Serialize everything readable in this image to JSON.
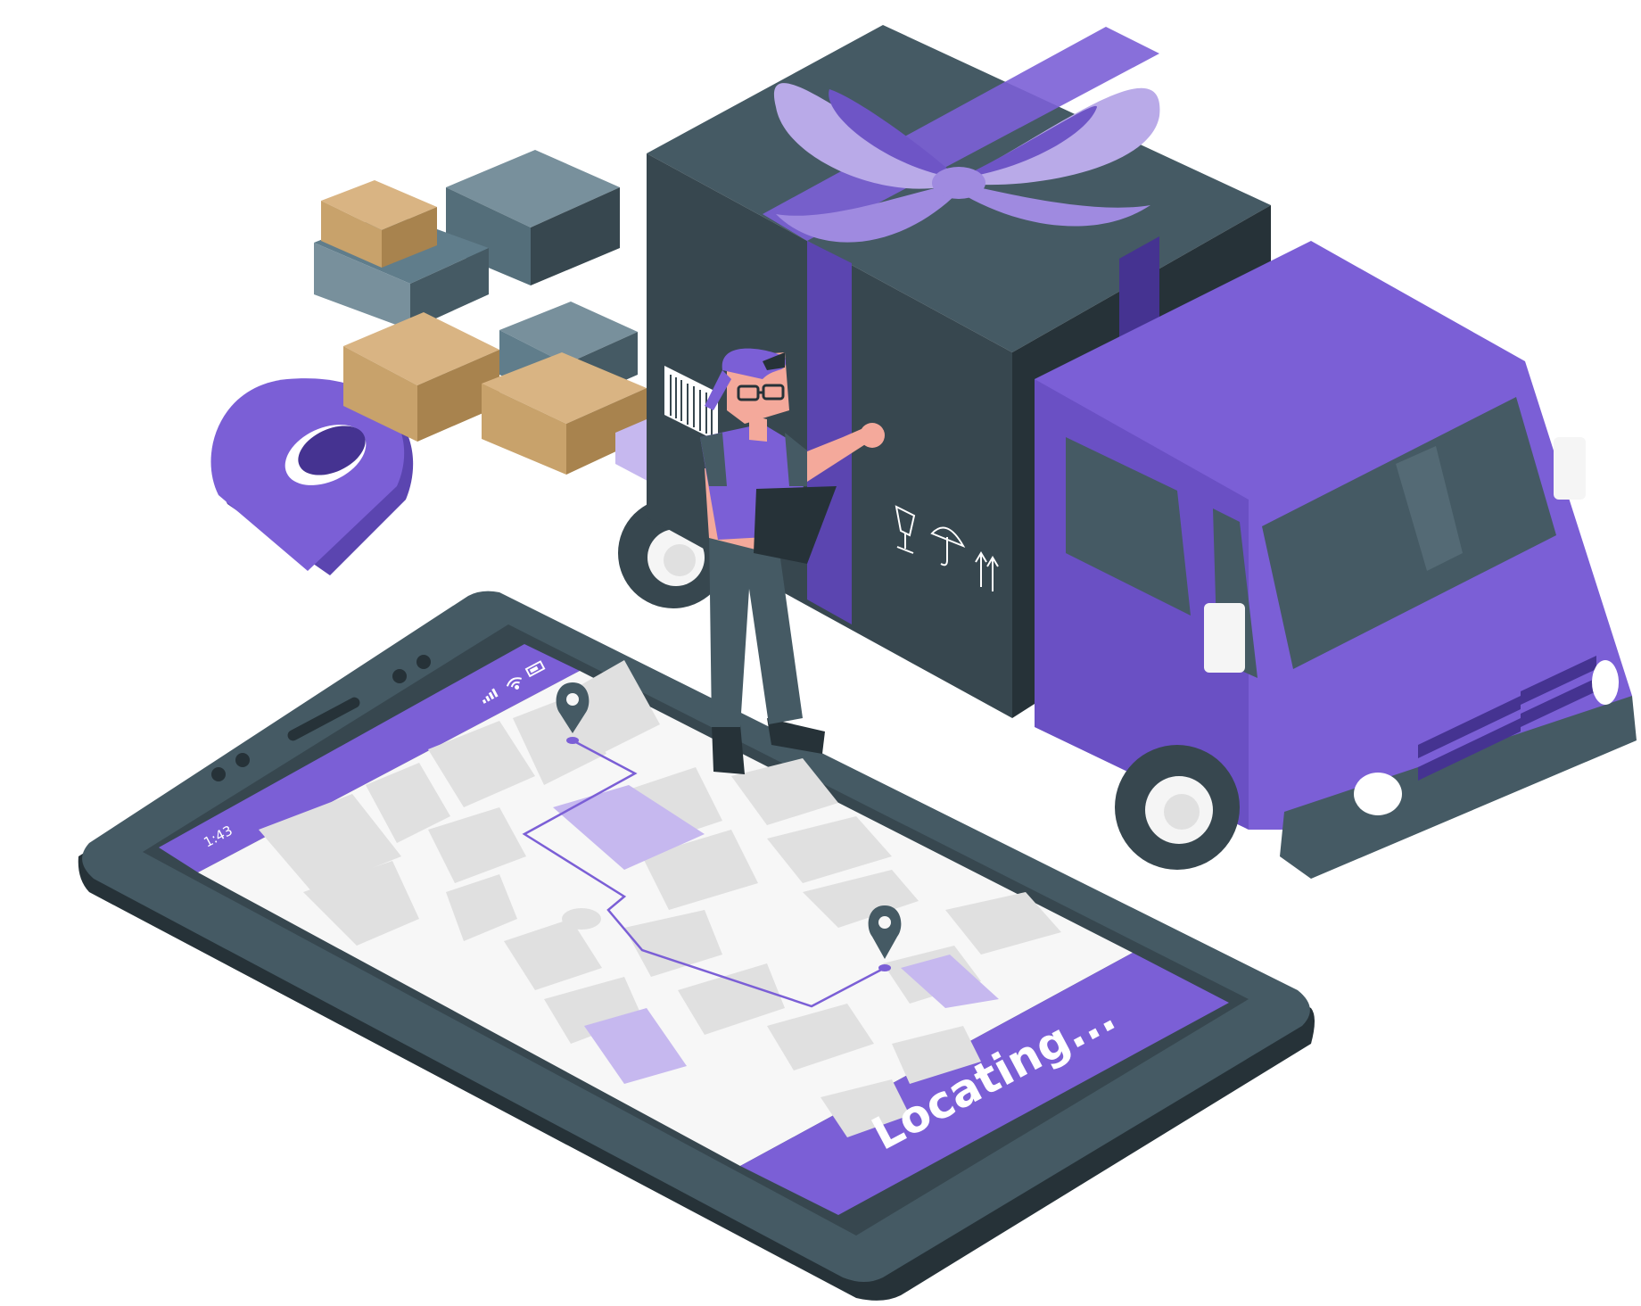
{
  "phone": {
    "status_time": "1:43",
    "banner_text": "Locating..."
  },
  "colors": {
    "accent": "#7b5fd6",
    "accent_dark": "#5b45b0",
    "accent_light": "#b9aae8",
    "dark": "#37474f",
    "darker": "#263238",
    "map_bg": "#f7f7f7",
    "map_block": "#e0e0e0",
    "cardboard": "#c8a26b"
  },
  "icons": [
    "signal-icon",
    "wifi-icon",
    "battery-icon",
    "location-pin-icon",
    "barcode-icon",
    "fragile-icon",
    "umbrella-icon",
    "this-side-up-icon"
  ]
}
